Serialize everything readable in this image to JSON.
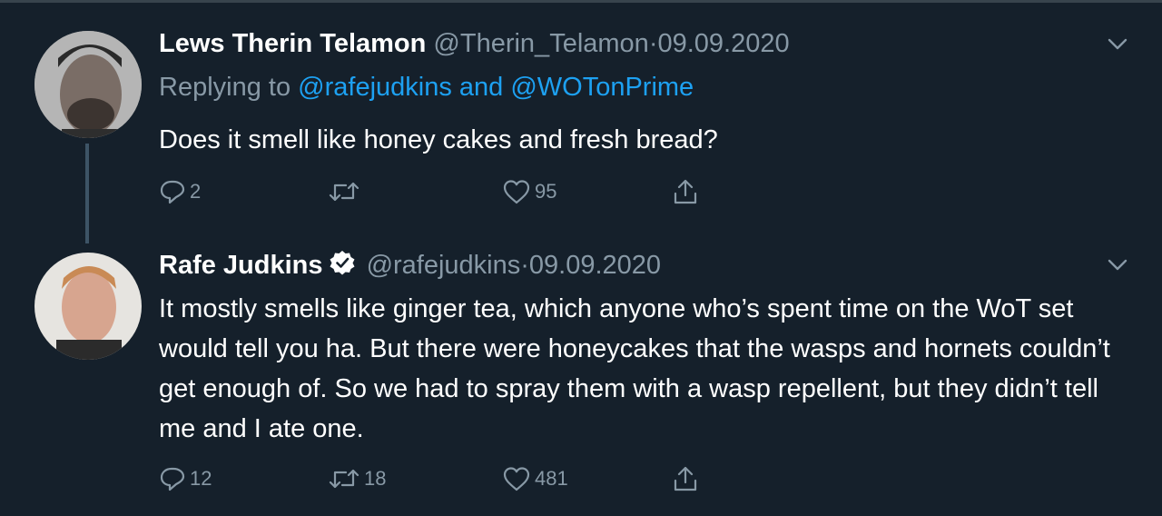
{
  "tweets": [
    {
      "author_name": "Lews Therin Telamon",
      "handle": "@Therin_Telamon",
      "separator": "·",
      "date": "09.09.2020",
      "reply_prefix": "Replying to",
      "reply_mentions": "@rafejudkins and @WOTonPrime",
      "text": "Does it smell like honey cakes and fresh bread?",
      "verified": false,
      "replies": "2",
      "retweets": "",
      "likes": "95"
    },
    {
      "author_name": "Rafe Judkins",
      "handle": "@rafejudkins",
      "separator": "·",
      "date": "09.09.2020",
      "text": "It mostly smells like ginger tea, which anyone who’s spent time on the WoT set would tell you ha. But there were honeycakes that the wasps and hornets couldn’t get enough of. So we had to spray them with a wasp repellent, but they didn’t tell me and I ate one.",
      "verified": true,
      "replies": "12",
      "retweets": "18",
      "likes": "481"
    }
  ],
  "colors": {
    "background": "#15202b",
    "muted": "#8899a6",
    "link": "#1da1f2",
    "text": "#ffffff",
    "thread_line": "#3d5466"
  },
  "icons": [
    "reply-icon",
    "retweet-icon",
    "like-icon",
    "share-icon",
    "chevron-down-icon",
    "verified-badge-icon"
  ]
}
